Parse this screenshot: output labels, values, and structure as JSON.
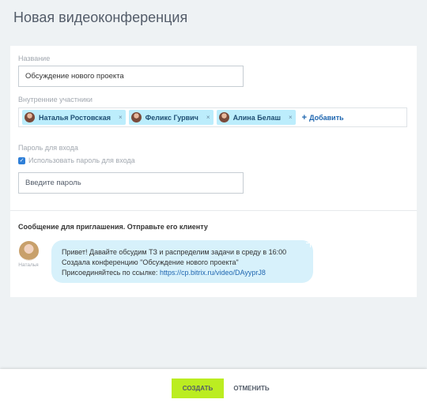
{
  "page": {
    "title": "Новая видеоконференция"
  },
  "form": {
    "name_label": "Название",
    "name_value": "Обсуждение нового проекта",
    "members_label": "Внутренние участники",
    "members": [
      {
        "name": "Наталья Ростовская"
      },
      {
        "name": "Феликс Гурвич"
      },
      {
        "name": "Алина Белаш"
      }
    ],
    "remove_glyph": "×",
    "add_label": "Добавить",
    "password_label": "Пароль для входа",
    "use_password_label": "Использовать пароль для входа",
    "password_placeholder": "Введите пароль"
  },
  "invite": {
    "title": "Сообщение для приглашения. Отправьте его клиенту",
    "sender_name": "Наталья",
    "line1": "Привет! Давайте обсудим ТЗ и распределим задачи в среду в 16:00",
    "line2": "Создала конференцию \"Обсуждение нового проекта\"",
    "line3_prefix": "Присоединяйтесь по ссылке: ",
    "link": "https://cp.bitrix.ru/video/DAyyprJ8"
  },
  "footer": {
    "create_label": "СОЗДАТЬ",
    "cancel_label": "ОТМЕНИТЬ"
  },
  "colors": {
    "accent_green": "#bbed21",
    "chip_blue": "#bcedfc",
    "bubble": "#d7f1fb",
    "link": "#2067b0"
  }
}
